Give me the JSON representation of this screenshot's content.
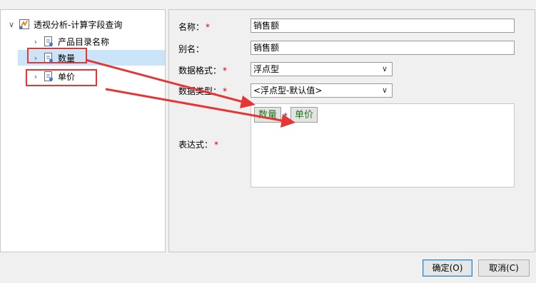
{
  "tree": {
    "root_label": "透视分析-计算字段查询",
    "items": [
      {
        "label": "产品目录名称"
      },
      {
        "label": "数量"
      },
      {
        "label": "单价"
      }
    ]
  },
  "form": {
    "name_label": "名称：",
    "name_value": "销售额",
    "alias_label": "别名：",
    "alias_value": "销售额",
    "format_label": "数据格式：",
    "format_value": "浮点型",
    "type_label": "数据类型：",
    "type_value": "<浮点型-默认值>",
    "expr_label": "表达式：",
    "required_mark": "*",
    "expr_tokens": [
      "数量",
      "*",
      "单价"
    ]
  },
  "footer": {
    "ok_label": "确定(O)",
    "cancel_label": "取消(C)"
  },
  "colors": {
    "annotation": "#e53535",
    "selection": "#cce4f7",
    "token_text": "#1f7a1f"
  }
}
